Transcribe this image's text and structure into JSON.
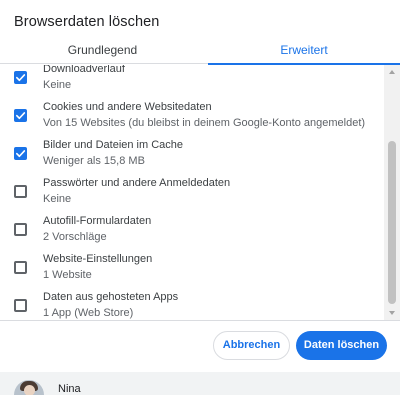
{
  "dialog": {
    "title": "Browserdaten löschen",
    "tabs": [
      {
        "label": "Grundlegend",
        "selected": false
      },
      {
        "label": "Erweitert",
        "selected": true
      }
    ],
    "items": [
      {
        "title": "Downloadverlauf",
        "subtitle": "Keine",
        "checked": true
      },
      {
        "title": "Cookies und andere Websitedaten",
        "subtitle": "Von 15 Websites (du bleibst in deinem Google-Konto angemeldet)",
        "checked": true
      },
      {
        "title": "Bilder und Dateien im Cache",
        "subtitle": "Weniger als 15,8 MB",
        "checked": true
      },
      {
        "title": "Passwörter und andere Anmeldedaten",
        "subtitle": "Keine",
        "checked": false
      },
      {
        "title": "Autofill-Formulardaten",
        "subtitle": "2 Vorschläge",
        "checked": false
      },
      {
        "title": "Website-Einstellungen",
        "subtitle": "1 Website",
        "checked": false
      },
      {
        "title": "Daten aus gehosteten Apps",
        "subtitle": "1 App (Web Store)",
        "checked": false
      }
    ],
    "buttons": {
      "cancel": "Abbrechen",
      "clear": "Daten löschen"
    },
    "account": {
      "name": "Nina"
    }
  },
  "colors": {
    "accent": "#1a73e8",
    "text": "#202124",
    "secondary_text": "#5f6368",
    "divider": "#dadce0"
  },
  "icons": {
    "checkbox_checked": "checkmark-icon",
    "avatar": "user-avatar"
  }
}
